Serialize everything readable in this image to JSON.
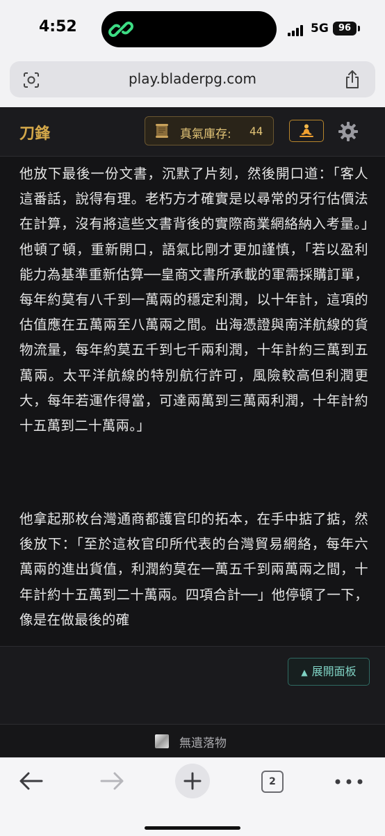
{
  "status_bar": {
    "time": "4:52",
    "network": "5G",
    "battery": "96"
  },
  "browser": {
    "url": "play.bladerpg.com",
    "tab_count": "2"
  },
  "app": {
    "title": "刀鋒",
    "qi": {
      "label": "真氣庫存:",
      "value": "44"
    },
    "accent_color": "#d4a84a",
    "story": {
      "paragraphs": [
        "他放下最後一份文書，沉默了片刻，然後開口道：「客人這番話，說得有理。老朽方才確實是以尋常的牙行估價法在計算，沒有將這些文書背後的實際商業網絡納入考量。」他頓了頓，重新開口，語氣比剛才更加謹慎，「若以盈利能力為基準重新估算──皇商文書所承載的軍需採購訂單，每年約莫有八千到一萬兩的穩定利潤，以十年計，這項的估值應在五萬兩至八萬兩之間。出海憑證與南洋航線的貨物流量，每年約莫五千到七千兩利潤，十年計約三萬到五萬兩。太平洋航線的特別航行許可，風險較高但利潤更大，每年若運作得當，可達兩萬到三萬兩利潤，十年計約十五萬到二十萬兩。」",
        "他拿起那枚台灣通商都護官印的拓本，在手中掂了掂，然後放下：「至於這枚官印所代表的台灣貿易網絡，每年六萬兩的進出貨值，利潤約莫在一萬五千到兩萬兩之間，十年計約十五萬到二十萬兩。四項合計──」他停頓了一下，像是在做最後的確"
      ]
    },
    "panel_toggle_label": "展開面板",
    "loot_label": "無遺落物"
  }
}
